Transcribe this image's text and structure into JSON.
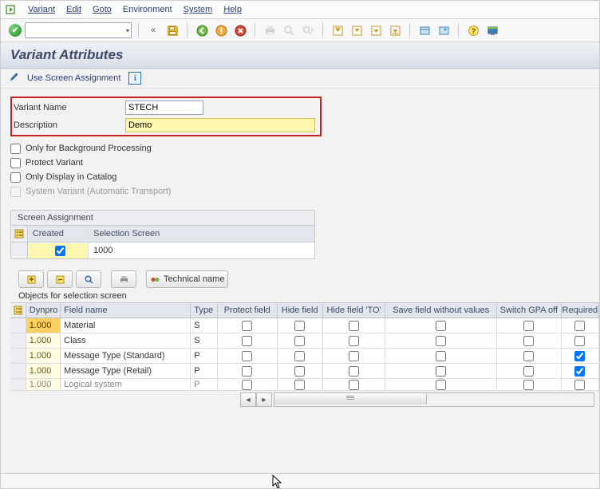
{
  "menu": {
    "items": [
      "Variant",
      "Edit",
      "Goto",
      "Environment",
      "System",
      "Help"
    ]
  },
  "title": "Variant Attributes",
  "subbar": {
    "use_screen_assignment": "Use Screen Assignment"
  },
  "form": {
    "variant_name_label": "Variant Name",
    "variant_name_value": "STECH",
    "description_label": "Description",
    "description_value": "Demo"
  },
  "checks": {
    "bg": "Only for Background Processing",
    "protect": "Protect Variant",
    "catalog": "Only Display in Catalog",
    "system_variant": "System Variant (Automatic Transport)"
  },
  "screen_assignment": {
    "title": "Screen Assignment",
    "col_created": "Created",
    "col_screen": "Selection Screen",
    "rows": [
      {
        "created": true,
        "screen": "1000"
      }
    ]
  },
  "lower_toolbar": {
    "technical_name": "Technical name"
  },
  "objects": {
    "section_label": "Objects for selection screen",
    "columns": {
      "dynpro": "Dynpro",
      "field": "Field name",
      "type": "Type",
      "protect": "Protect field",
      "hide": "Hide field",
      "hide_to": "Hide field 'TO'",
      "save": "Save field without values",
      "gpa": "Switch GPA off",
      "required": "Required"
    },
    "rows": [
      {
        "dynpro": "1.000",
        "field": "Material",
        "type": "S",
        "protect": false,
        "hide": false,
        "hide_to": false,
        "save": false,
        "gpa": false,
        "required": false
      },
      {
        "dynpro": "1.000",
        "field": "Class",
        "type": "S",
        "protect": false,
        "hide": false,
        "hide_to": false,
        "save": false,
        "gpa": false,
        "required": false
      },
      {
        "dynpro": "1.000",
        "field": "Message Type (Standard)",
        "type": "P",
        "protect": false,
        "hide": false,
        "hide_to": false,
        "save": false,
        "gpa": false,
        "required": true
      },
      {
        "dynpro": "1.000",
        "field": "Message Type (Retail)",
        "type": "P",
        "protect": false,
        "hide": false,
        "hide_to": false,
        "save": false,
        "gpa": false,
        "required": true
      },
      {
        "dynpro": "1.000",
        "field": "Logical system",
        "type": "P",
        "protect": false,
        "hide": false,
        "hide_to": false,
        "save": false,
        "gpa": false,
        "required": false
      }
    ]
  }
}
